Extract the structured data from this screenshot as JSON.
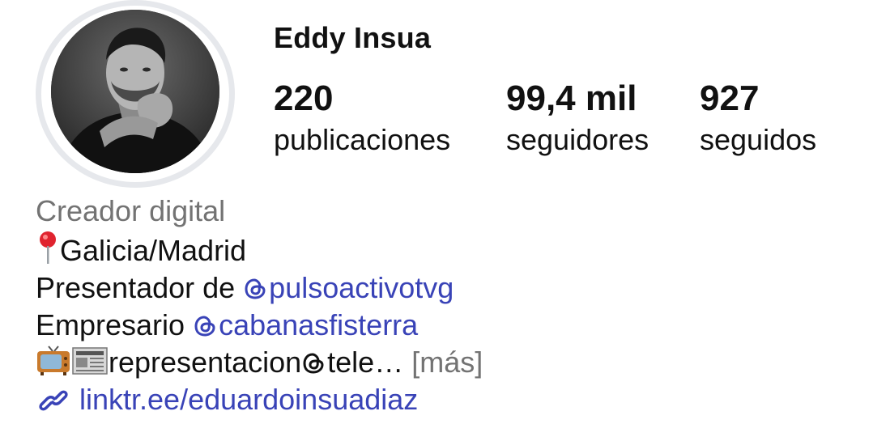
{
  "profile": {
    "username": "Eddy Insua",
    "stats": [
      {
        "value": "220",
        "label": "publicaciones"
      },
      {
        "value": "99,4 mil",
        "label": "seguidores"
      },
      {
        "value": "927",
        "label": "seguidos"
      }
    ]
  },
  "bio": {
    "category": "Creador digital",
    "location": "Galicia/Madrid",
    "presenter_prefix": "Presentador de ",
    "presenter_handle": "pulsoactivotvg",
    "business_prefix": "Empresario ",
    "business_handle": "cabanasfisterra",
    "contact_prefix": "representacion",
    "contact_suffix": "tele…",
    "more_label": "[más]",
    "link": "linktr.ee/eduardoinsuadiaz"
  },
  "icons": {
    "location": "round-pushpin-icon",
    "threads": "threads-icon",
    "tv": "television-icon",
    "news": "newspaper-icon",
    "link": "link-icon"
  },
  "colors": {
    "mention": "#3943b7",
    "secondary_text": "#737373",
    "avatar_ring": "#e6e8ec"
  }
}
